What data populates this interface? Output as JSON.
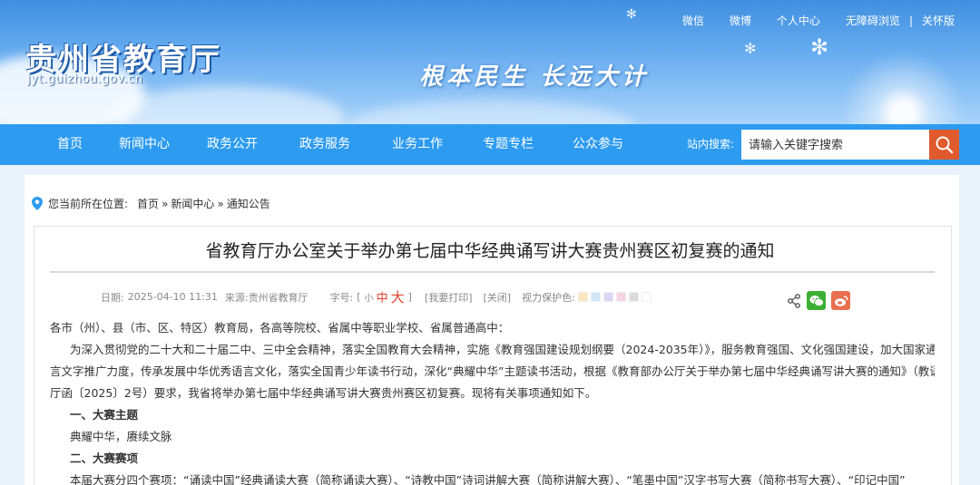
{
  "header": {
    "site_title": "贵州省教育厅",
    "domain": "jyt.guizhou.gov.cn",
    "slogan": "根本民生 长远大计",
    "top_links": [
      "微信",
      "微博",
      "个人中心",
      "无障碍浏览",
      "|",
      "关怀版"
    ]
  },
  "nav": {
    "items": [
      "首页",
      "新闻中心",
      "政务公开",
      "政务服务",
      "业务工作",
      "专题专栏",
      "公众参与"
    ],
    "search_label": "站内搜索:",
    "search_placeholder": "请输入关键字搜索",
    "search_icon": "search-icon"
  },
  "breadcrumb": {
    "prefix": "您当前所在位置:",
    "items": [
      "首页",
      "»",
      "新闻中心",
      "»",
      "通知公告"
    ]
  },
  "article": {
    "title": "省教育厅办公室关于举办第七届中华经典诵写讲大赛贵州赛区初复赛的通知",
    "date_label": "日期:",
    "date": "2025-04-10 11:31",
    "source_label": "来源:",
    "source": "贵州省教育厅",
    "font_label": "字号:",
    "font_open": "[",
    "font_small": "小",
    "font_medium": "中",
    "font_large": "大",
    "font_close": "]",
    "print": "[我要打印]",
    "close": "[关闭]",
    "eye_label": "视力保护色:",
    "eye_colors": [
      "#fbe6c2",
      "#cfe6f7",
      "#d8d7f5",
      "#f7d3e3",
      "#dcdcdc",
      "#ffffff"
    ],
    "paragraphs": [
      "各市（州）、县（市、区、特区）教育局，各高等院校、省属中等职业学校、省属普通高中：",
      "为深入贯彻党的二十大和二十届二中、三中全会精神，落实全国教育大会精神，实施《教育强国建设规划纲要（2024-2035年）》，服务教育强国、文化强国建设，加大国家通用语",
      "言文字推广力度，传承发展中华优秀语言文化，落实全国青少年读书行动，深化“典耀中华”主题读书活动，根据《教育部办公厅关于举办第七届中华经典诵写讲大赛的通知》（教语用",
      "厅函〔2025〕2号）要求，我省将举办第七届中华经典诵写讲大赛贵州赛区初复赛。现将有关事项通知如下。",
      "一、大赛主题",
      "典耀中华，赓续文脉",
      "二、大赛赛项",
      "本届大赛分四个赛项：“诵读中国”经典诵读大赛（简称诵读大赛）、“诗教中国”诗词讲解大赛（简称讲解大赛）、“笔墨中国”汉字书写大赛（简称书写大赛）、“印记中国”"
    ]
  }
}
